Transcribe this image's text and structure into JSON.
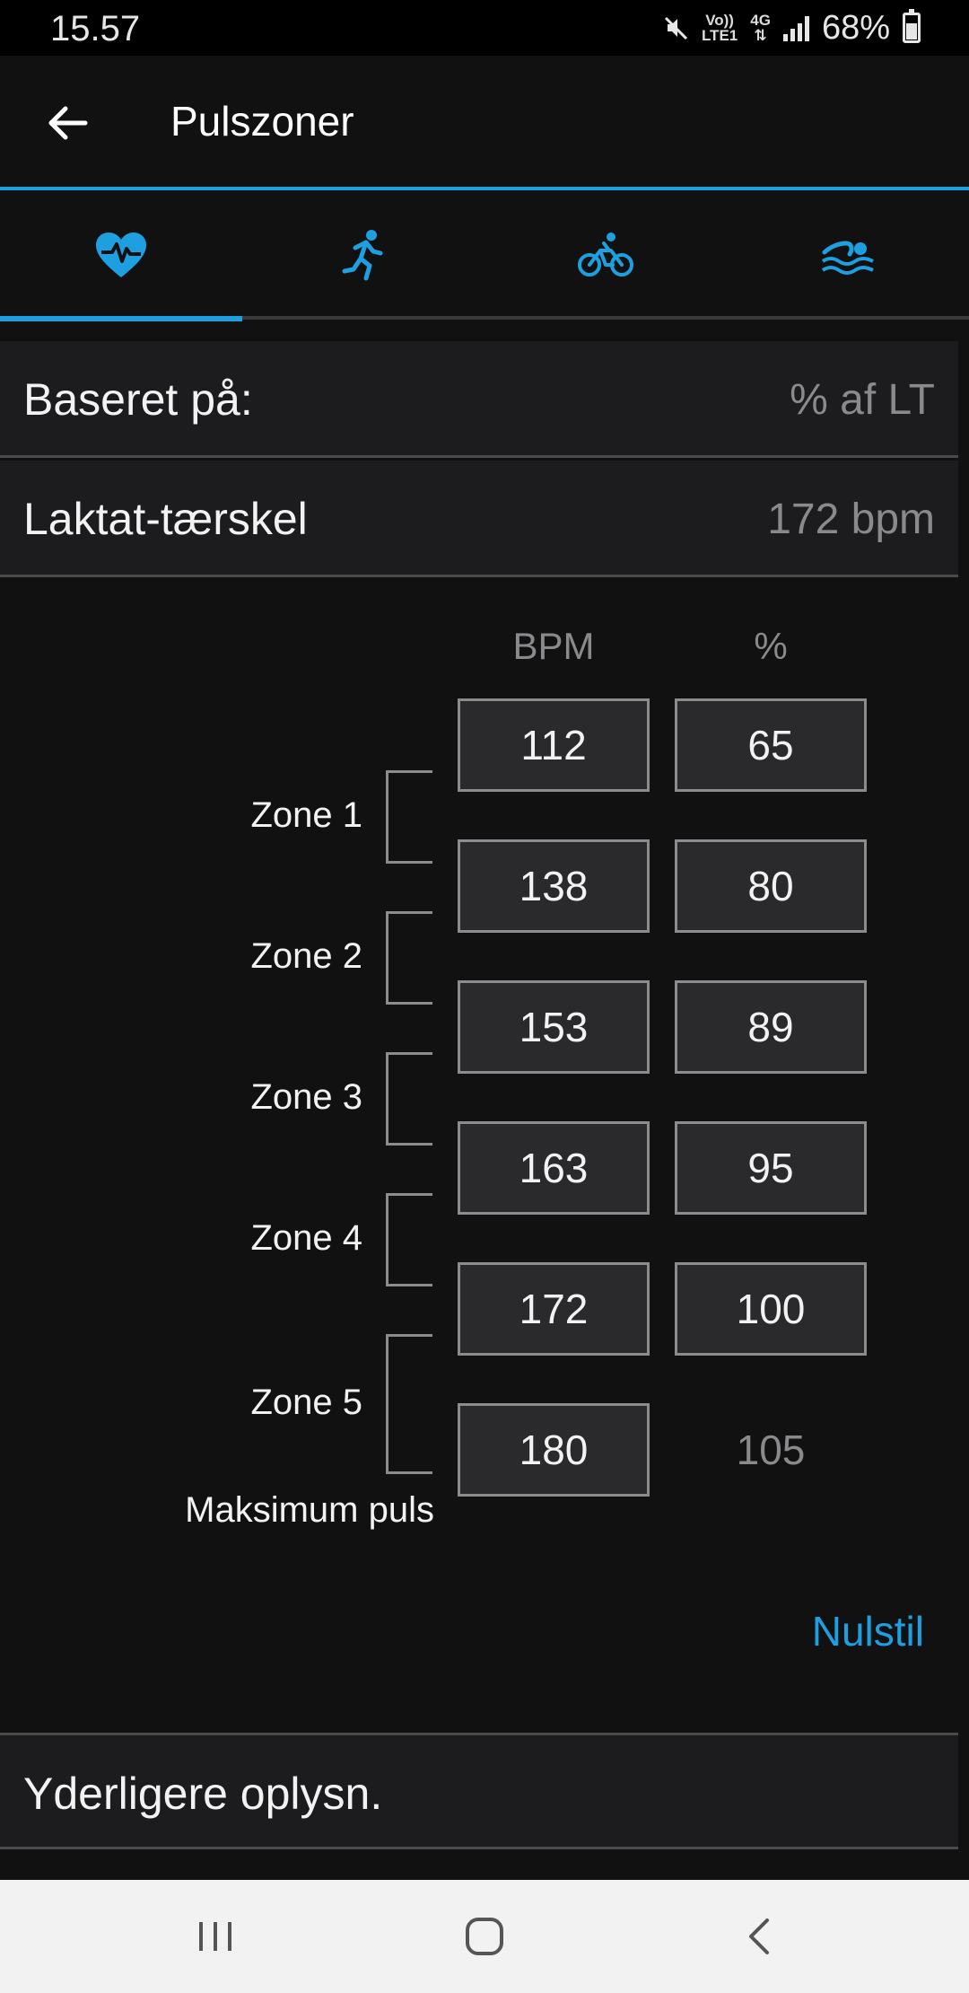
{
  "status_bar": {
    "time": "15.57",
    "network_line1": "Vo))",
    "network_line2": "LTE1",
    "network_type": "4G",
    "battery": "68%",
    "icons": [
      "mute-icon",
      "signal-icon",
      "battery-icon"
    ]
  },
  "header": {
    "title": "Pulszoner",
    "back_icon": "arrow-left-icon",
    "accent_color": "#1ea0e0"
  },
  "tabs": [
    {
      "icon": "heart-rate-icon",
      "selected": true
    },
    {
      "icon": "running-icon",
      "selected": false
    },
    {
      "icon": "cycling-icon",
      "selected": false
    },
    {
      "icon": "swimming-icon",
      "selected": false
    }
  ],
  "settings": {
    "based_on": {
      "label": "Baseret på:",
      "value": "% af LT"
    },
    "threshold": {
      "label": "Laktat-tærskel",
      "value": "172 bpm"
    }
  },
  "zones": {
    "col_bpm": "BPM",
    "col_pct": "%",
    "bpm_values": [
      "112",
      "138",
      "153",
      "163",
      "172",
      "180"
    ],
    "pct_values": [
      "65",
      "80",
      "89",
      "95",
      "100",
      "105"
    ],
    "labels": [
      "Zone 1",
      "Zone 2",
      "Zone 3",
      "Zone 4",
      "Zone 5"
    ],
    "max_label": "Maksimum puls"
  },
  "reset_label": "Nulstil",
  "more_info": {
    "label": "Yderligere oplysn."
  },
  "nav": {
    "recents_icon": "recents-icon",
    "home_icon": "home-icon",
    "back_icon": "nav-back-icon"
  }
}
